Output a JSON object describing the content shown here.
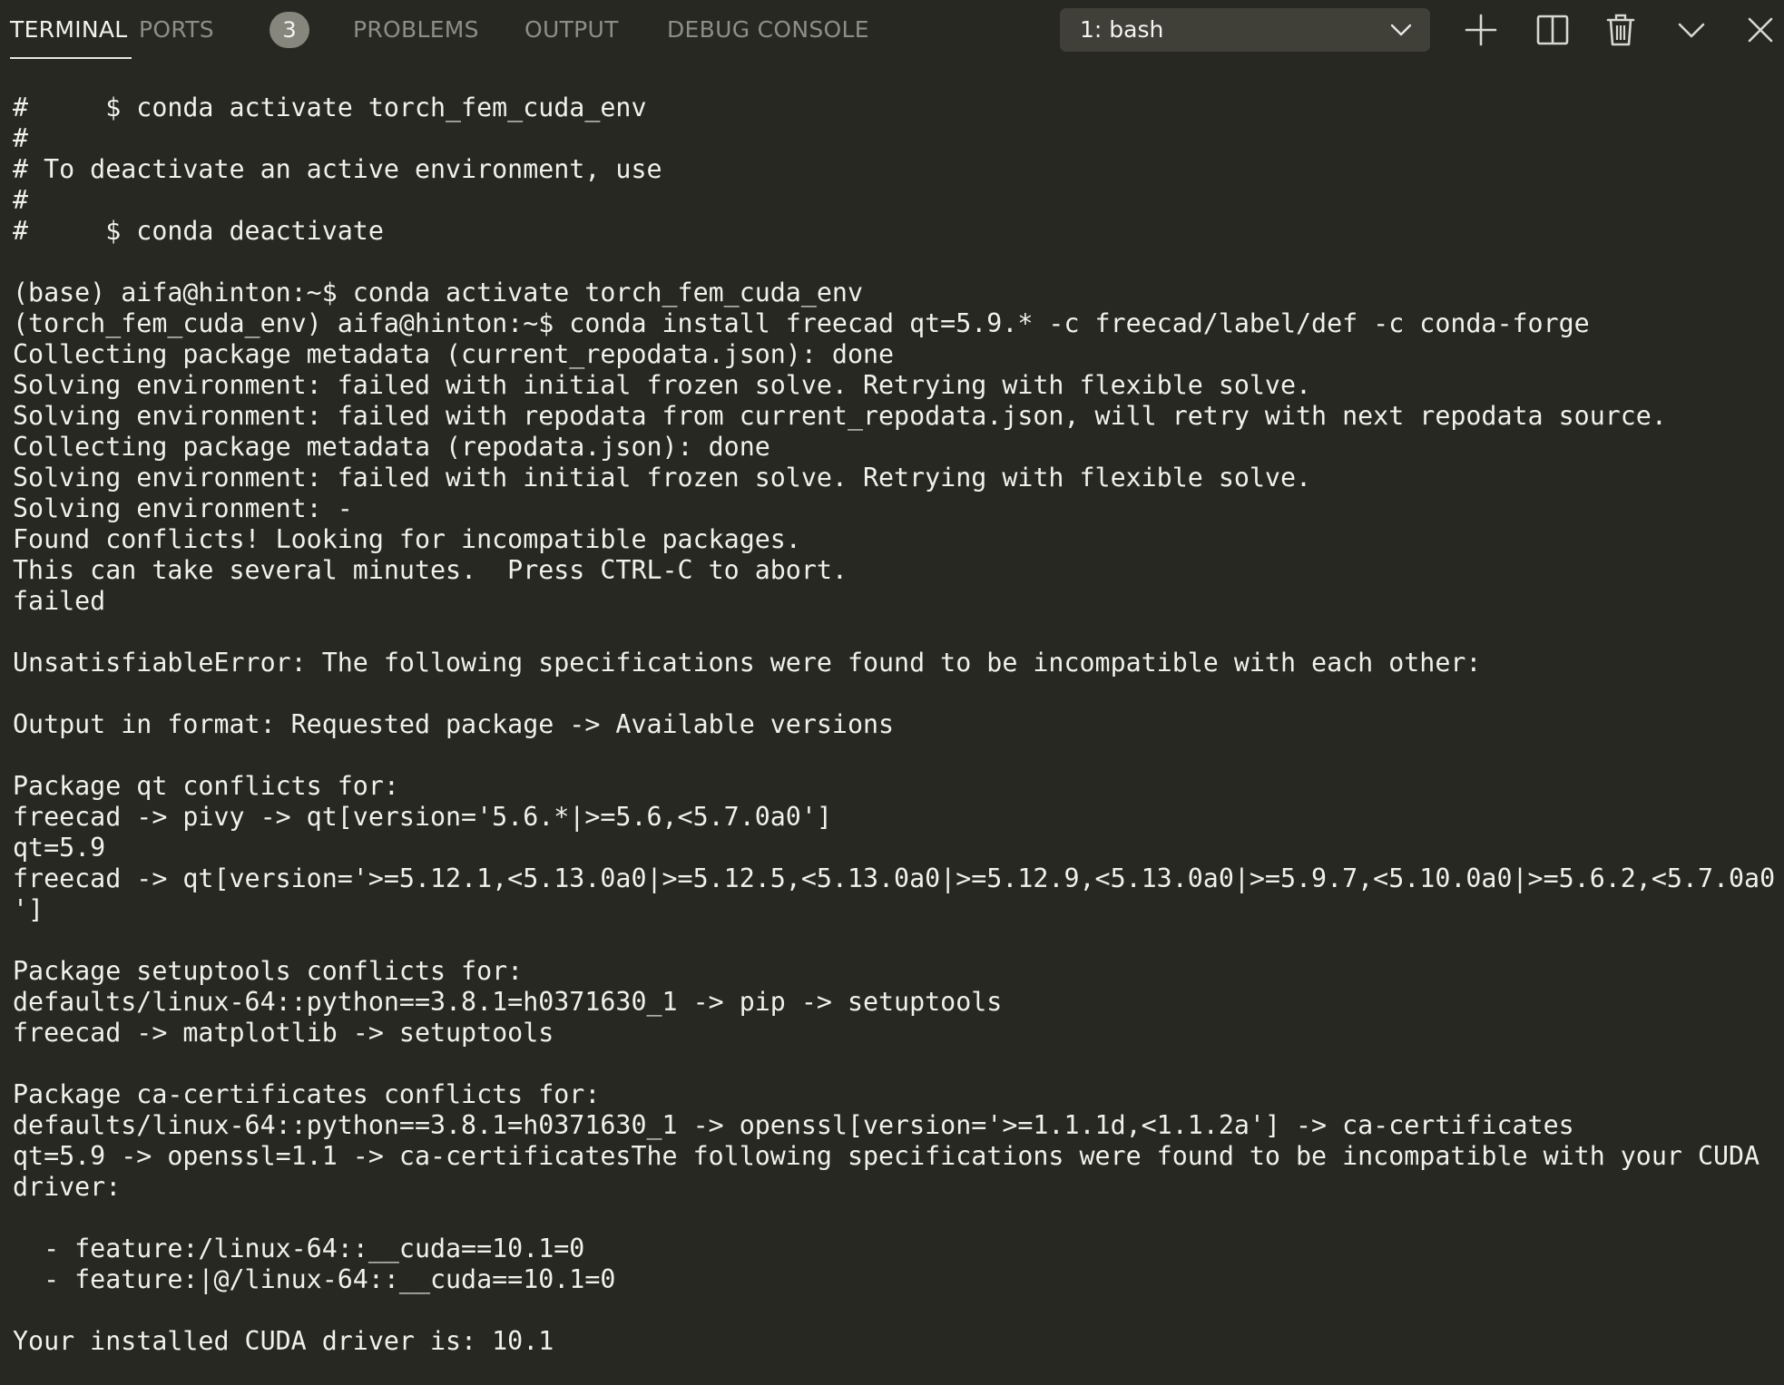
{
  "tabs": {
    "terminal": "TERMINAL",
    "ports": "PORTS",
    "ports_badge": "3",
    "problems": "PROBLEMS",
    "output": "OUTPUT",
    "debug_console": "DEBUG CONSOLE"
  },
  "terminal_selector": {
    "selected": "1: bash"
  },
  "icons": {
    "chevron": "chevron-down-icon",
    "add": "plus-icon",
    "split": "split-icon",
    "trash": "trash-icon",
    "maximize": "chevron-down-icon",
    "close": "close-icon"
  },
  "colors": {
    "background": "#272822",
    "text": "#f1f1ec",
    "tab_inactive": "#8e8e87",
    "badge": "#86867d",
    "selector": "#404038"
  },
  "terminal": {
    "lines": [
      "#     $ conda activate torch_fem_cuda_env",
      "#",
      "# To deactivate an active environment, use",
      "#",
      "#     $ conda deactivate",
      "",
      "(base) aifa@hinton:~$ conda activate torch_fem_cuda_env",
      "(torch_fem_cuda_env) aifa@hinton:~$ conda install freecad qt=5.9.* -c freecad/label/def -c conda-forge",
      "Collecting package metadata (current_repodata.json): done",
      "Solving environment: failed with initial frozen solve. Retrying with flexible solve.",
      "Solving environment: failed with repodata from current_repodata.json, will retry with next repodata source.",
      "Collecting package metadata (repodata.json): done",
      "Solving environment: failed with initial frozen solve. Retrying with flexible solve.",
      "Solving environment: -",
      "Found conflicts! Looking for incompatible packages.",
      "This can take several minutes.  Press CTRL-C to abort.",
      "failed",
      "",
      "UnsatisfiableError: The following specifications were found to be incompatible with each other:",
      "",
      "Output in format: Requested package -> Available versions",
      "",
      "Package qt conflicts for:",
      "freecad -> pivy -> qt[version='5.6.*|>=5.6,<5.7.0a0']",
      "qt=5.9",
      "freecad -> qt[version='>=5.12.1,<5.13.0a0|>=5.12.5,<5.13.0a0|>=5.12.9,<5.13.0a0|>=5.9.7,<5.10.0a0|>=5.6.2,<5.7.0a0",
      "']",
      "",
      "Package setuptools conflicts for:",
      "defaults/linux-64::python==3.8.1=h0371630_1 -> pip -> setuptools",
      "freecad -> matplotlib -> setuptools",
      "",
      "Package ca-certificates conflicts for:",
      "defaults/linux-64::python==3.8.1=h0371630_1 -> openssl[version='>=1.1.1d,<1.1.2a'] -> ca-certificates",
      "qt=5.9 -> openssl=1.1 -> ca-certificatesThe following specifications were found to be incompatible with your CUDA",
      "driver:",
      "",
      "  - feature:/linux-64::__cuda==10.1=0",
      "  - feature:|@/linux-64::__cuda==10.1=0",
      "",
      "Your installed CUDA driver is: 10.1"
    ]
  }
}
